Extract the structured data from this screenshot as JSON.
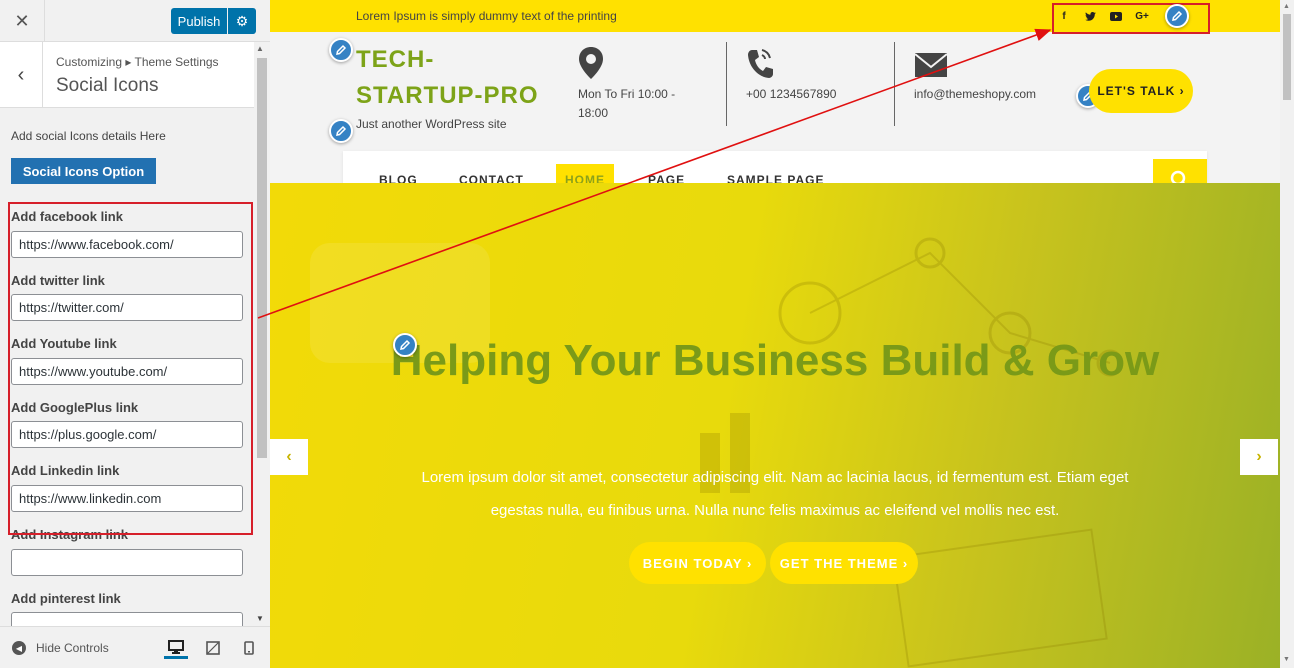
{
  "sidebar": {
    "publish_label": "Publish",
    "breadcrumb": "Customizing ▸ Theme Settings",
    "section_title": "Social Icons",
    "description": "Add social Icons details Here",
    "option_button": "Social Icons Option",
    "fields": [
      {
        "label": "Add facebook link",
        "value": "https://www.facebook.com/"
      },
      {
        "label": "Add twitter link",
        "value": "https://twitter.com/"
      },
      {
        "label": "Add Youtube link",
        "value": "https://www.youtube.com/"
      },
      {
        "label": "Add GooglePlus link",
        "value": "https://plus.google.com/"
      },
      {
        "label": "Add Linkedin link",
        "value": "https://www.linkedin.com"
      },
      {
        "label": "Add Instagram link",
        "value": ""
      },
      {
        "label": "Add pinterest link",
        "value": ""
      }
    ],
    "footer": {
      "hide_controls": "Hide Controls"
    }
  },
  "preview": {
    "topbar_text": "Lorem Ipsum is simply dummy text of the printing",
    "social_icons": [
      {
        "icon": "facebook-icon",
        "glyph": "f"
      },
      {
        "icon": "twitter-icon",
        "glyph": "t"
      },
      {
        "icon": "youtube-icon",
        "glyph": "▶"
      },
      {
        "icon": "googleplus-icon",
        "glyph": "G+"
      }
    ],
    "site_title": "TECH-STARTUP-PRO",
    "tagline": "Just another WordPress site",
    "hours": "Mon To Fri 10:00 - 18:00",
    "phone": "+00 1234567890",
    "email": "info@themeshopy.com",
    "cta": "LET'S TALK",
    "nav": [
      "BLOG",
      "CONTACT",
      "HOME",
      "PAGE",
      "SAMPLE PAGE"
    ],
    "nav_active": "HOME",
    "hero": {
      "title": "Helping Your Business Build & Grow",
      "text": "Lorem ipsum dolor sit amet, consectetur adipiscing elit. Nam ac lacinia lacus, id fermentum est. Etiam eget egestas nulla, eu finibus urna. Nulla nunc felis maximus ac eleifend vel mollis nec est.",
      "button1": "BEGIN TODAY ›",
      "button2": "GET THE THEME ›"
    }
  },
  "colors": {
    "accent_yellow": "#ffe100",
    "title_green": "#7da318",
    "wp_blue": "#0073aa",
    "highlight_red": "#d61f2a"
  }
}
